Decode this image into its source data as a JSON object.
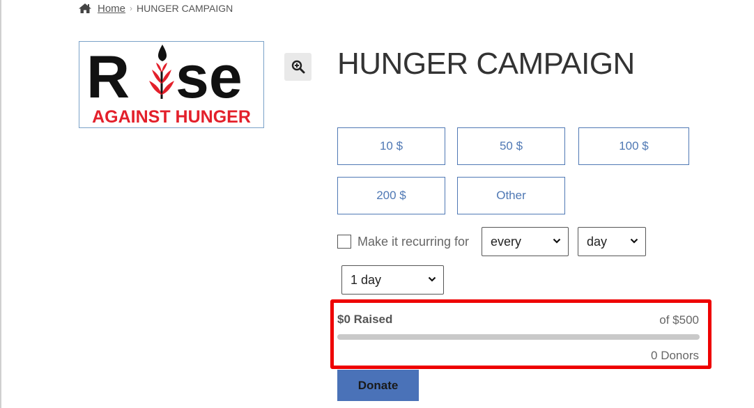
{
  "breadcrumb": {
    "home_label": "Home",
    "separator": "›",
    "current": "HUNGER CAMPAIGN"
  },
  "logo": {
    "main_text_1": "R",
    "main_text_2": "se",
    "sub_text": "AGAINST HUNGER",
    "accent_color": "#e3202b",
    "icon": "rise-logo-wheat-drop"
  },
  "zoom": {
    "icon": "zoom-in-icon"
  },
  "product": {
    "title": "HUNGER CAMPAIGN"
  },
  "amounts": [
    "10 $",
    "50 $",
    "100 $",
    "200 $",
    "Other"
  ],
  "recurring": {
    "checkbox_checked": false,
    "label": "Make it recurring for",
    "frequency_select": "every",
    "unit_select": "day",
    "duration_select": "1 day"
  },
  "progress": {
    "raised": "$0 Raised",
    "goal": "of $500",
    "fraction": 0,
    "donors": "0 Donors"
  },
  "donate": {
    "label": "Donate"
  },
  "colors": {
    "brand_blue": "#4f78b4",
    "highlight_red": "#ee0000"
  }
}
